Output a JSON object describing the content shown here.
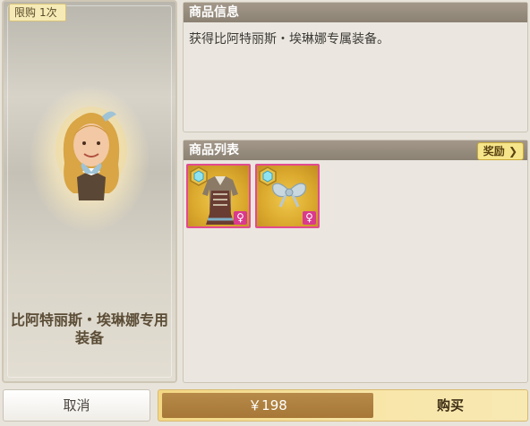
{
  "limit": {
    "prefix": "限购",
    "count": "1次"
  },
  "item_name": "比阿特丽斯・埃琳娜专用装备",
  "info_panel": {
    "title": "商品信息",
    "description": "获得比阿特丽斯・埃琳娜专属装备。"
  },
  "list_panel": {
    "title": "商品列表",
    "reward_button": "奖励 ❯"
  },
  "items": [
    {
      "icon": "armor-outfit-icon",
      "gender": "♀"
    },
    {
      "icon": "hair-bow-icon",
      "gender": "♀"
    }
  ],
  "footer": {
    "cancel_label": "取消",
    "price": "￥198",
    "buy_label": "购买"
  },
  "colors": {
    "slot_border": "#e34a8f",
    "gender_badge": "#d93a8c",
    "header_bg": "#9a8f80",
    "price_bg": "#ad7f3d"
  }
}
